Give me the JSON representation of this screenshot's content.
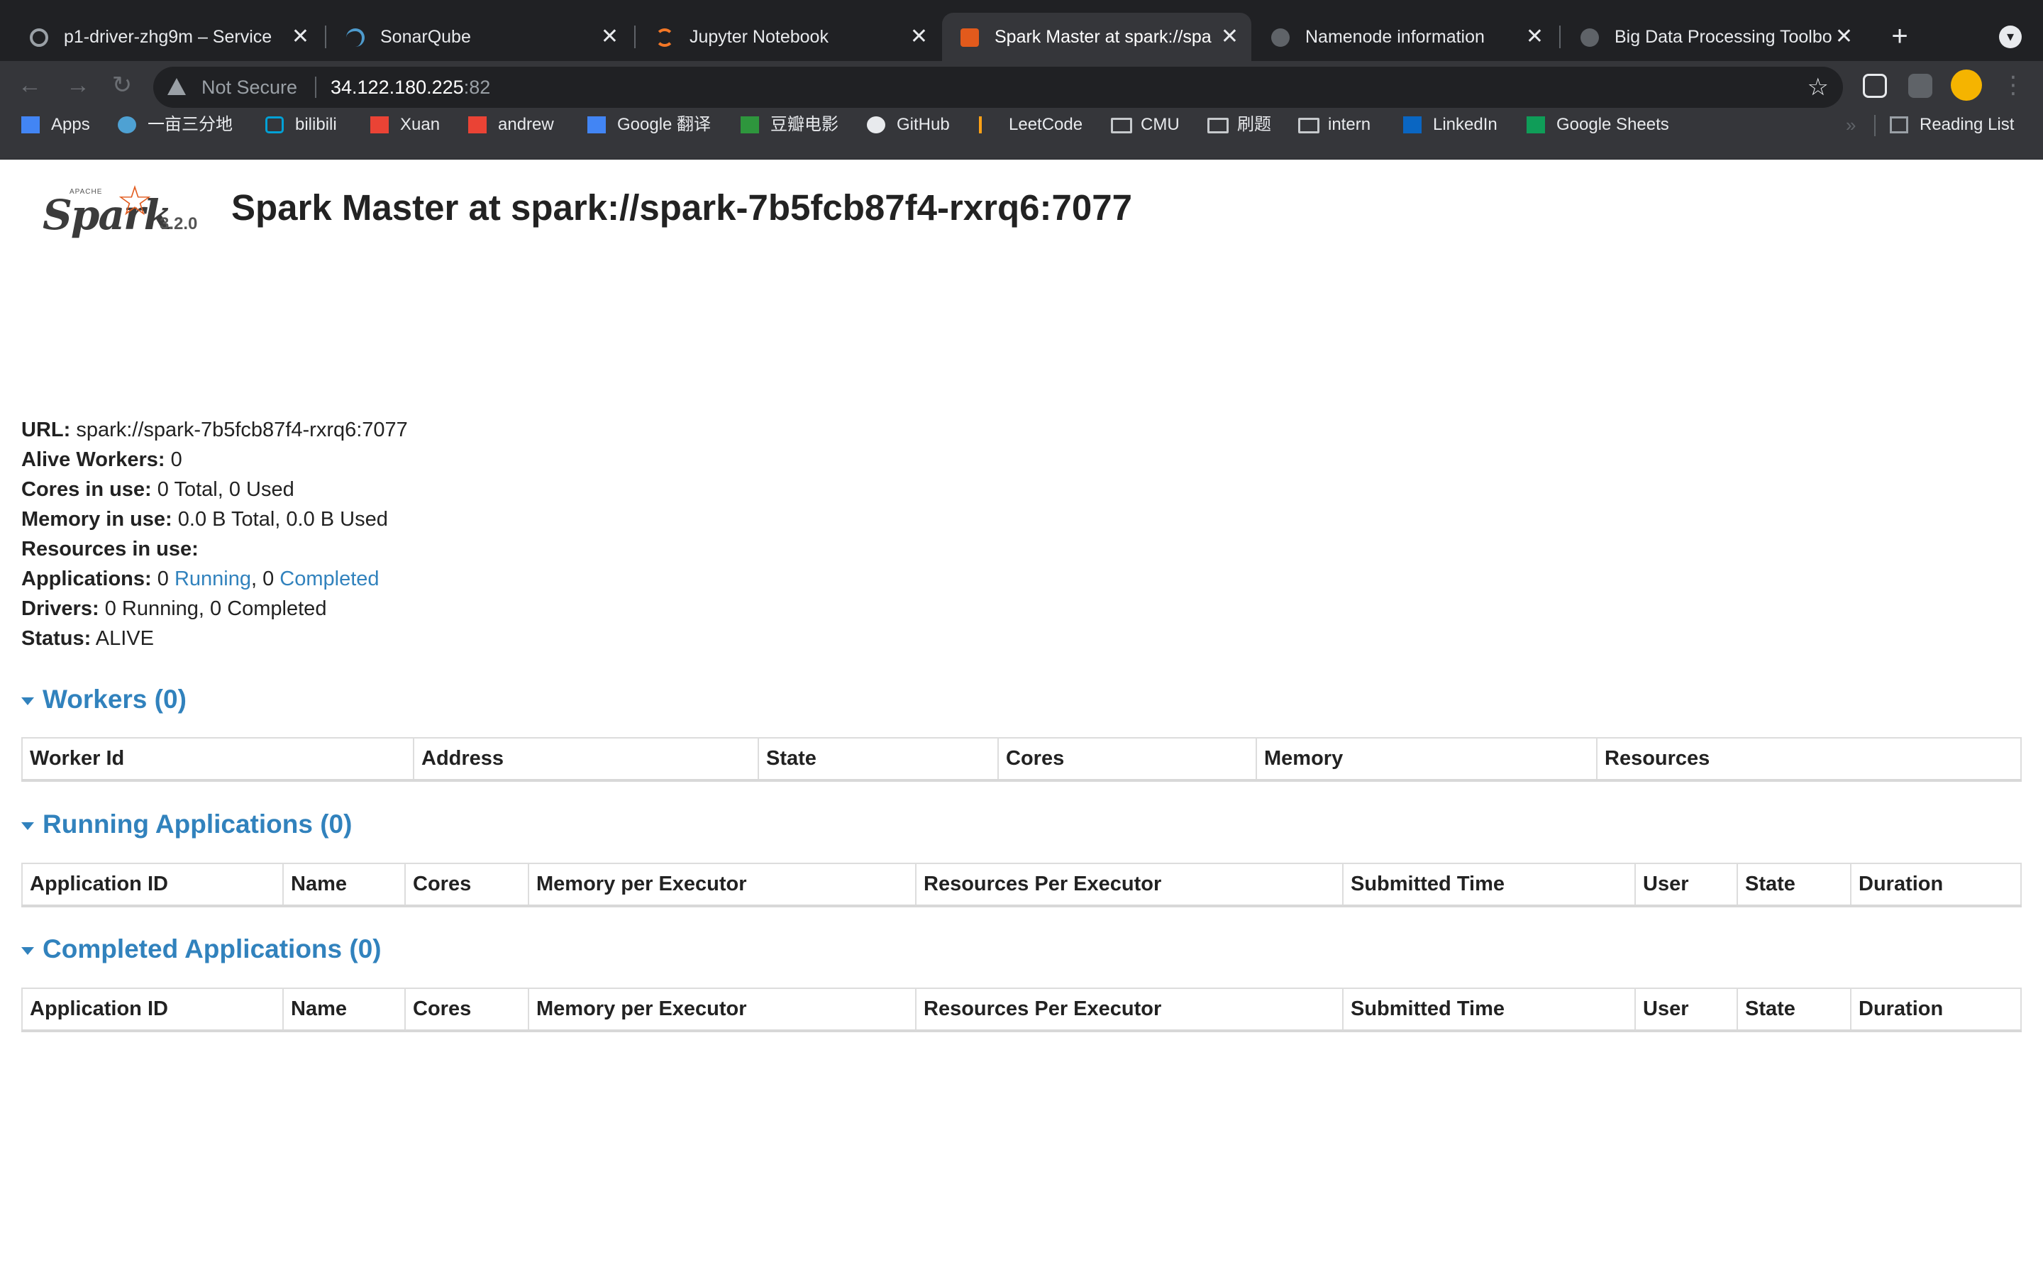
{
  "tabs": [
    {
      "title": "p1-driver-zhg9m – Service",
      "icon_color": "#9aa0a6"
    },
    {
      "title": "SonarQube",
      "icon_color": "#4e9bcd"
    },
    {
      "title": "Jupyter Notebook",
      "icon_color": "#f37726"
    },
    {
      "title": "Spark Master at spark://spa",
      "icon_color": "#e25a1c"
    },
    {
      "title": "Namenode information",
      "icon_color": "#9aa0a6"
    },
    {
      "title": "Big Data Processing Toolbo",
      "icon_color": "#9aa0a6"
    }
  ],
  "omnibox": {
    "security_label": "Not Secure",
    "host": "34.122.180.225",
    "port": ":82"
  },
  "bookmarks": [
    {
      "label": "Apps",
      "icon": "apps-grid-icon",
      "color": "#4285f4"
    },
    {
      "label": "一亩三分地",
      "icon": "bird-icon",
      "color": "#4ea1d3"
    },
    {
      "label": "bilibili",
      "icon": "tv-icon",
      "color": "#00a1d6"
    },
    {
      "label": "Xuan",
      "icon": "gmail-icon",
      "color": "#ea4335"
    },
    {
      "label": "andrew",
      "icon": "gmail-icon",
      "color": "#ea4335"
    },
    {
      "label": "Google 翻译",
      "icon": "translate-icon",
      "color": "#4285f4"
    },
    {
      "label": "豆瓣电影",
      "icon": "douban-icon",
      "color": "#2e963d"
    },
    {
      "label": "GitHub",
      "icon": "github-icon",
      "color": "#e8eaed"
    },
    {
      "label": "LeetCode",
      "icon": "leetcode-icon",
      "color": "#ffa116"
    },
    {
      "label": "CMU",
      "icon": "folder-icon",
      "color": "#c6c9cc"
    },
    {
      "label": "刷题",
      "icon": "folder-icon",
      "color": "#c6c9cc"
    },
    {
      "label": "intern",
      "icon": "folder-icon",
      "color": "#c6c9cc"
    },
    {
      "label": "LinkedIn",
      "icon": "linkedin-icon",
      "color": "#0a66c2"
    },
    {
      "label": "Google Sheets",
      "icon": "sheets-icon",
      "color": "#0f9d58"
    }
  ],
  "reading_list": "Reading List",
  "spark": {
    "logo_text": "Spark",
    "logo_apache": "APACHE",
    "version": "3.2.0",
    "title": "Spark Master at spark://spark-7b5fcb87f4-rxrq6:7077",
    "summary": {
      "url_label": "URL:",
      "url_value": "spark://spark-7b5fcb87f4-rxrq6:7077",
      "alive_label": "Alive Workers:",
      "alive_value": "0",
      "cores_label": "Cores in use:",
      "cores_value": "0 Total, 0 Used",
      "memory_label": "Memory in use:",
      "memory_value": "0.0 B Total, 0.0 B Used",
      "resources_label": "Resources in use:",
      "apps_label": "Applications:",
      "apps_running_count": "0",
      "apps_running_link": "Running",
      "apps_sep": ", 0",
      "apps_completed_link": "Completed",
      "drivers_label": "Drivers:",
      "drivers_value": "0 Running, 0 Completed",
      "status_label": "Status:",
      "status_value": "ALIVE"
    },
    "workers": {
      "heading": "Workers (0)",
      "columns": [
        "Worker Id",
        "Address",
        "State",
        "Cores",
        "Memory",
        "Resources"
      ]
    },
    "running": {
      "heading": "Running Applications (0)",
      "columns": [
        "Application ID",
        "Name",
        "Cores",
        "Memory per Executor",
        "Resources Per Executor",
        "Submitted Time",
        "User",
        "State",
        "Duration"
      ]
    },
    "completed": {
      "heading": "Completed Applications (0)",
      "columns": [
        "Application ID",
        "Name",
        "Cores",
        "Memory per Executor",
        "Resources Per Executor",
        "Submitted Time",
        "User",
        "State",
        "Duration"
      ]
    }
  }
}
